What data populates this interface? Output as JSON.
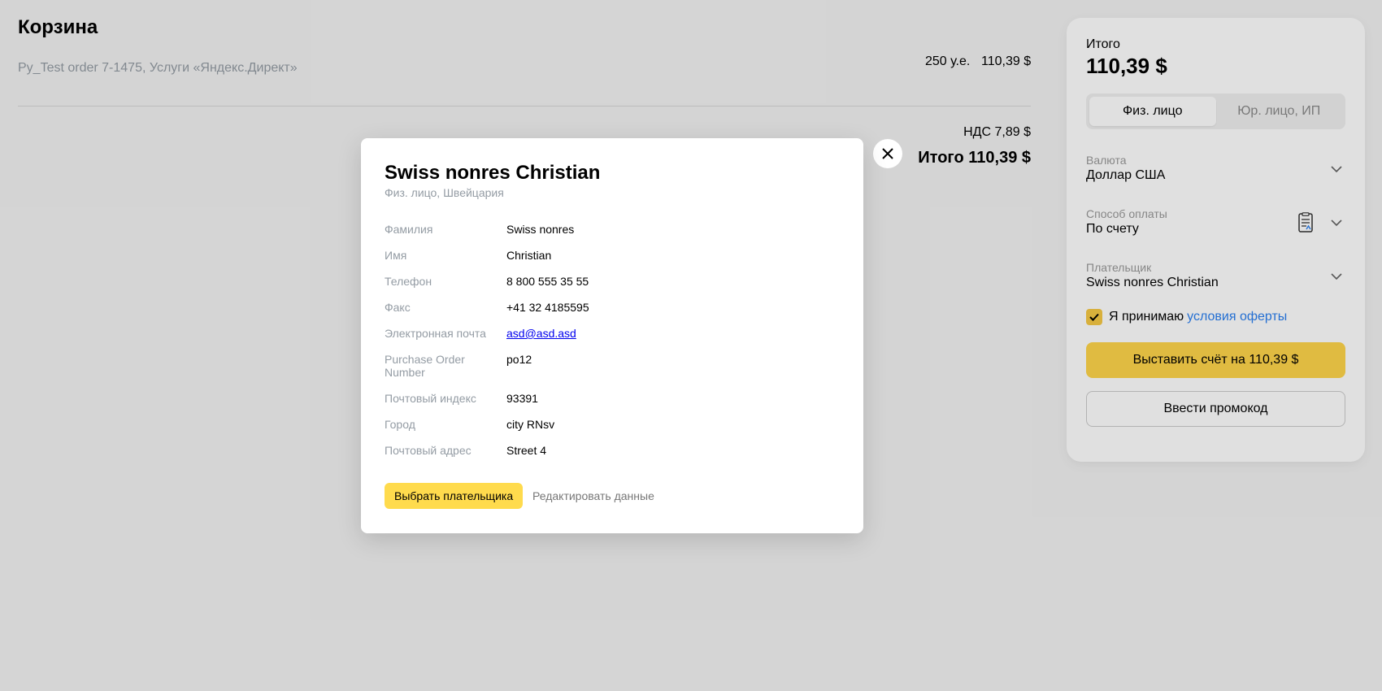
{
  "cart": {
    "title": "Корзина",
    "order_description": "Py_Test order 7-1475, Услуги «Яндекс.Директ»",
    "order_quantity": "250 у.е.",
    "order_price": "110,39 $",
    "vat": "НДС 7,89 $",
    "total": "Итого 110,39 $"
  },
  "panel": {
    "total_label": "Итого",
    "total_amount": "110,39 $",
    "person_types": [
      "Физ. лицо",
      "Юр. лицо, ИП"
    ],
    "person_type_selected": "Физ. лицо",
    "currency": {
      "label": "Валюта",
      "value": "Доллар США"
    },
    "payment": {
      "label": "Способ оплаты",
      "value": "По счету",
      "icon": "document-icon"
    },
    "payer": {
      "label": "Плательщик",
      "value": "Swiss nonres Christian"
    },
    "agree_text": "Я принимаю",
    "agree_link": "условия оферты",
    "agree_checked": true,
    "invoice_button": "Выставить счёт на 110,39 $",
    "promo_button": "Ввести промокод",
    "colors": {
      "accent": "#ffd54a",
      "link": "#2a7ff0"
    }
  },
  "modal": {
    "title": "Swiss nonres Christian",
    "subtitle": "Физ. лицо, Швейцария",
    "fields": [
      {
        "label": "Фамилия",
        "value": "Swiss nonres"
      },
      {
        "label": "Имя",
        "value": "Christian"
      },
      {
        "label": "Телефон",
        "value": "8 800 555 35 55"
      },
      {
        "label": "Факс",
        "value": "+41 32 4185595"
      },
      {
        "label": "Электронная почта",
        "value": "asd@asd.asd"
      },
      {
        "label": "Purchase Order Number",
        "value": "po12"
      },
      {
        "label": "Почтовый индекс",
        "value": "93391"
      },
      {
        "label": "Город",
        "value": "city RNsv"
      },
      {
        "label": "Почтовый адрес",
        "value": "Street 4"
      }
    ],
    "choose_button": "Выбрать плательщика",
    "edit_button": "Редактировать данные"
  }
}
